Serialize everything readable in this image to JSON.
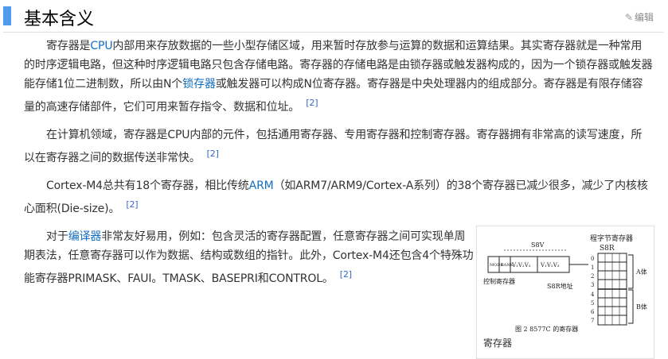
{
  "header": {
    "title": "基本含义",
    "edit_label": "编辑"
  },
  "p1": {
    "t1": "寄存器是",
    "link1": "CPU",
    "t2": "内部用来存放数据的一些小型存储区域，用来暂时存放参与运算的数据和运算结果。其实寄存器就是一种常用的时序逻辑电路，但这种时序逻辑电路只包含存储电路。寄存器的存储电路是由锁存器或触发器构成的，因为一个锁存器或触发器能存储1位二进制数，所以由N个",
    "link2": "锁存器",
    "t3": "或触发器可以构成N位寄存器。寄存器是中央处理器内的组成部分。寄存器是有限存储容量的高速存储部件，它们可用来暂存指令、数据和位址。",
    "ref": "[2]"
  },
  "p2": {
    "t1": "在计算机领域，寄存器是CPU内部的元件，包括通用寄存器、专用寄存器和控制寄存器。寄存器拥有非常高的读写速度，所以在寄存器之间的数据传送非常快。",
    "ref": "[2]"
  },
  "p3": {
    "t1": "Cortex-M4总共有18个寄存器，相比传统",
    "link1": "ARM",
    "t2": "（如ARM7/ARM9/Cortex-A系列）的38个寄存器已减少很多，减少了内核核心面积(Die-size)。",
    "ref": "[2]"
  },
  "p4": {
    "t1": "对于",
    "link1": "编译器",
    "t2": "非常友好易用，例如：包含灵活的寄存器配置，任意寄存器之间可实现单周期表法，任意寄存器可以作为数据、结构或数组的指针。此外，Cortex-M4还包含4个特殊功能寄存器PRIMASK、FAUI。TMASK、BASEPRI和CONTROL。",
    "ref": "[2]"
  },
  "figure": {
    "caption": "寄存器",
    "diagram": {
      "top_label": "程字节寄存器",
      "s8r_top": "S8R",
      "s8v": "S8V",
      "mode": "MODE",
      "bank": "BANK",
      "vfields1": "V₁V₂V₃",
      "vfields2": "V₁V₂V₃",
      "ctrl_label": "控制寄存器",
      "addr_label": "S8R地址",
      "block_a": "A体",
      "block_b": "B体",
      "rows": [
        "0",
        "1",
        "2",
        "3",
        "4",
        "5",
        "6",
        "7"
      ],
      "fig_caption": "图 2    8577C 的寄存器"
    }
  }
}
